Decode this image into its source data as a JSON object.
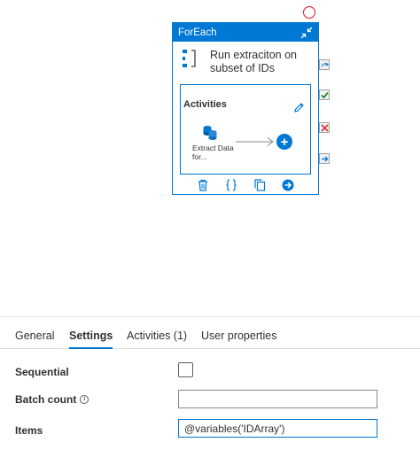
{
  "card": {
    "header_title": "ForEach",
    "activity_title": "Run extraciton on subset of IDs",
    "activities_label": "Activities",
    "inner_activity_name": "Extract Data for...",
    "add_symbol": "+",
    "accent_color": "#0078d4"
  },
  "status_marker_color": "#e81123",
  "side_icons": [
    "skip-icon",
    "success-check-icon",
    "failure-x-icon",
    "completion-arrow-icon"
  ],
  "tabs": [
    {
      "label": "General",
      "active": false
    },
    {
      "label": "Settings",
      "active": true
    },
    {
      "label": "Activities (1)",
      "active": false
    },
    {
      "label": "User properties",
      "active": false
    }
  ],
  "settings": {
    "sequential_label": "Sequential",
    "sequential_checked": false,
    "batch_count_label": "Batch count",
    "info_symbol": "i",
    "batch_count_value": "",
    "items_label": "Items",
    "items_value": "@variables('IDArray')"
  }
}
